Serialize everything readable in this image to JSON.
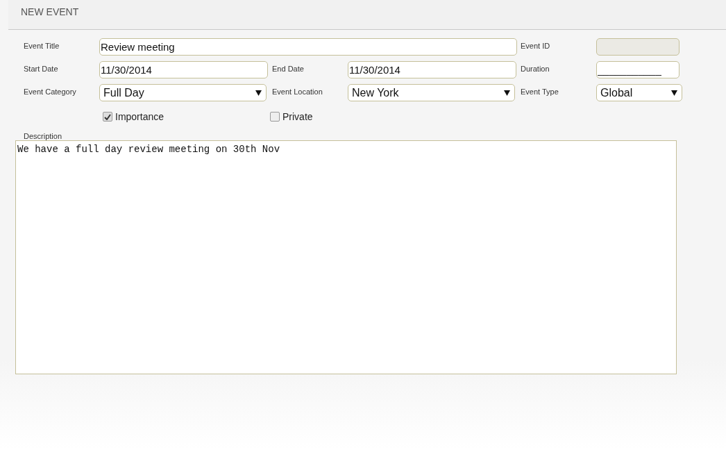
{
  "window": {
    "title": "NEW EVENT"
  },
  "fields": [
    {
      "kind": "text",
      "label": "Event Title",
      "value": "Review meeting",
      "wide": true
    },
    {
      "kind": "text",
      "label": "Event ID",
      "disabled": true
    },
    {
      "kind": "text",
      "label": "Start Date",
      "value": "11/30/2014"
    },
    {
      "kind": "text",
      "label": "End Date",
      "value": "11/30/2014"
    },
    {
      "kind": "text",
      "label": "Duration",
      "value": "___________"
    },
    {
      "kind": "select",
      "label": "Event Category",
      "value": "Full Day"
    },
    {
      "kind": "select",
      "label": "Event Location",
      "value": "New York"
    },
    {
      "kind": "select",
      "label": "Event Type",
      "value": "Global"
    }
  ],
  "checkboxes": [
    {
      "label": "Importance",
      "checked": true
    },
    {
      "label": "Private",
      "checked": false
    }
  ],
  "description": {
    "label": "Description",
    "value": "We have a full day review meeting on 30th Nov"
  }
}
